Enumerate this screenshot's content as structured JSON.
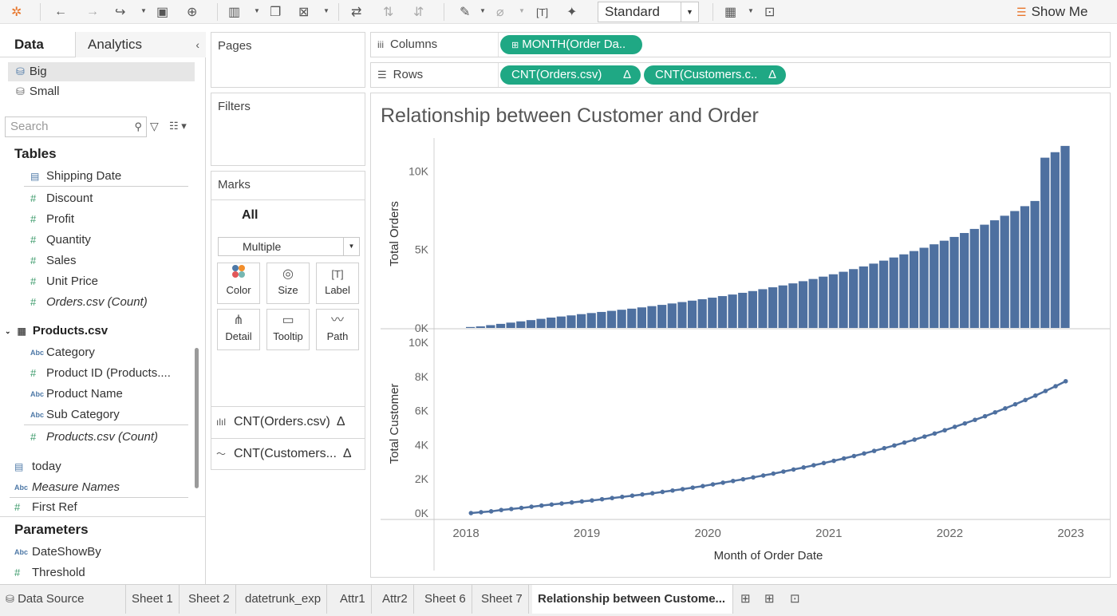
{
  "toolbar": {
    "fit_select": "Standard",
    "show_me": "Show Me"
  },
  "data_pane": {
    "tab_data": "Data",
    "tab_analytics": "Analytics",
    "datasources": [
      {
        "label": "Big",
        "selected": true
      },
      {
        "label": "Small",
        "selected": false
      }
    ],
    "search_placeholder": "Search",
    "tables_title": "Tables",
    "fields_orders": [
      {
        "label": "Shipping Date",
        "type": "date"
      },
      {
        "label": "Discount",
        "type": "measure"
      },
      {
        "label": "Profit",
        "type": "measure"
      },
      {
        "label": "Quantity",
        "type": "measure"
      },
      {
        "label": "Sales",
        "type": "measure"
      },
      {
        "label": "Unit Price",
        "type": "measure"
      },
      {
        "label": "Orders.csv (Count)",
        "type": "measure"
      }
    ],
    "products_table": "Products.csv",
    "fields_products": [
      {
        "label": "Category",
        "type": "string"
      },
      {
        "label": "Product ID (Products....",
        "type": "measure"
      },
      {
        "label": "Product Name",
        "type": "string"
      },
      {
        "label": "Sub Category",
        "type": "string"
      },
      {
        "label": "Products.csv (Count)",
        "type": "measure"
      }
    ],
    "extra_fields": [
      {
        "label": "today",
        "type": "date"
      },
      {
        "label": "Measure Names",
        "type": "string"
      },
      {
        "label": "First Ref",
        "type": "measure"
      }
    ],
    "parameters_title": "Parameters",
    "parameters": [
      {
        "label": "DateShowBy",
        "type": "string"
      },
      {
        "label": "Threshold",
        "type": "measure"
      }
    ]
  },
  "cards": {
    "pages": "Pages",
    "filters": "Filters",
    "marks": "Marks",
    "marks_all": "All",
    "mark_type": "Multiple",
    "mark_buttons": [
      "Color",
      "Size",
      "Label",
      "Detail",
      "Tooltip",
      "Path"
    ],
    "mark_pills": [
      "CNT(Orders.csv)",
      "CNT(Customers..."
    ]
  },
  "shelves": {
    "columns_label": "Columns",
    "rows_label": "Rows",
    "columns_pills": [
      "MONTH(Order Da.."
    ],
    "rows_pills": [
      "CNT(Orders.csv)",
      "CNT(Customers.c.."
    ],
    "delta": "Δ"
  },
  "viz": {
    "title": "Relationship between Customer and Order"
  },
  "chart_data": {
    "type": "bar+line",
    "title": "Relationship between Customer and Order",
    "xlabel": "Month of Order Date",
    "x_ticks": [
      "2018",
      "2019",
      "2020",
      "2021",
      "2022",
      "2023"
    ],
    "months_count": 60,
    "x_start": "2018-01",
    "series": [
      {
        "name": "CNT(Orders.csv)",
        "mark": "bar",
        "ylabel": "Total Orders",
        "y_ticks": [
          "0K",
          "5K",
          "10K"
        ],
        "ylim": [
          0,
          12000
        ],
        "color": "#4e70a0",
        "values": [
          60,
          100,
          180,
          260,
          340,
          420,
          500,
          580,
          660,
          730,
          800,
          880,
          950,
          1020,
          1090,
          1160,
          1230,
          1310,
          1390,
          1470,
          1560,
          1650,
          1740,
          1830,
          1930,
          2030,
          2130,
          2240,
          2350,
          2470,
          2590,
          2710,
          2840,
          2980,
          3120,
          3270,
          3420,
          3580,
          3750,
          3920,
          4100,
          4290,
          4490,
          4690,
          4900,
          5110,
          5330,
          5560,
          5800,
          6050,
          6310,
          6580,
          6860,
          7150,
          7450,
          7760,
          8090,
          10850,
          11200,
          11600
        ]
      },
      {
        "name": "CNT(Customers.csv)",
        "mark": "line",
        "ylabel": "Total Customer",
        "y_ticks": [
          "0K",
          "2K",
          "4K",
          "6K",
          "8K",
          "10K"
        ],
        "ylim": [
          0,
          10000
        ],
        "color": "#4e70a0",
        "values": [
          0,
          50,
          100,
          180,
          240,
          300,
          370,
          440,
          500,
          560,
          620,
          680,
          740,
          810,
          880,
          950,
          1020,
          1090,
          1160,
          1240,
          1320,
          1400,
          1490,
          1580,
          1680,
          1780,
          1880,
          1980,
          2090,
          2200,
          2310,
          2430,
          2550,
          2670,
          2800,
          2930,
          3060,
          3200,
          3340,
          3490,
          3640,
          3800,
          3960,
          4130,
          4300,
          4480,
          4660,
          4850,
          5050,
          5250,
          5460,
          5670,
          5900,
          6130,
          6370,
          6620,
          6880,
          7150,
          7430,
          7720
        ]
      }
    ]
  },
  "tabs": {
    "data_source": "Data Source",
    "sheets": [
      "Sheet 1",
      "Sheet 2",
      "datetrunk_exp",
      "Attr1",
      "Attr2",
      "Sheet 6",
      "Sheet 7",
      "Relationship between Custome..."
    ],
    "active_index": 7
  }
}
